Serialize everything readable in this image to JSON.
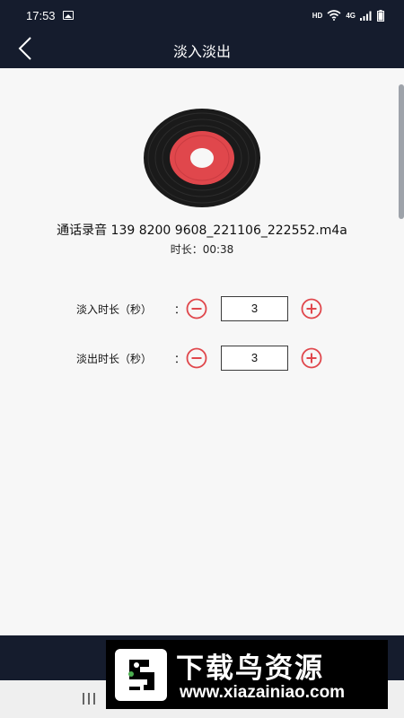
{
  "status_bar": {
    "time": "17:53",
    "network": "HD",
    "network_gen": "4G",
    "icons": [
      "image-icon",
      "wifi-icon",
      "signal-icon",
      "battery-icon"
    ]
  },
  "header": {
    "title": "淡入淡出",
    "back_icon": "back-arrow-icon"
  },
  "file": {
    "name": "通话录音 139 8200 9608_221106_222552.m4a",
    "duration_label": "时长：00:38"
  },
  "settings": {
    "fade_in": {
      "label": "淡入时长（秒）",
      "colon": "：",
      "value": "3"
    },
    "fade_out": {
      "label": "淡出时长（秒）",
      "colon": "：",
      "value": "3"
    }
  },
  "watermark": {
    "title": "下载鸟资源",
    "url": "www.xiazainiao.com"
  },
  "colors": {
    "header_bg": "#151c2d",
    "accent": "#e0474c",
    "page_bg": "#f7f7f7"
  }
}
